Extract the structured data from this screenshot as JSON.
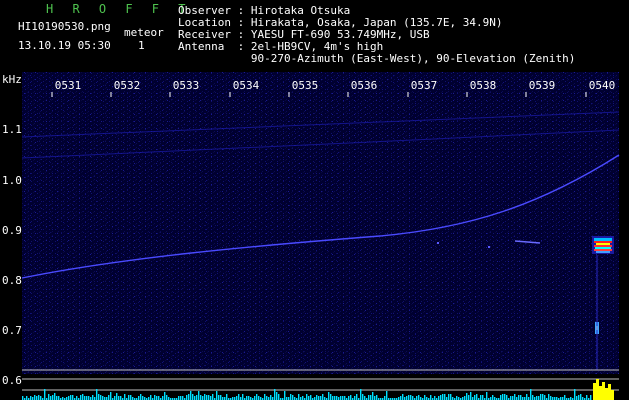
{
  "header": {
    "title": "H R O F F T",
    "filename": "HI10190530.png",
    "detect_label": "meteor",
    "datetime": "13.10.19 05:30",
    "count": "1",
    "info_lines": [
      "Observer : Hirotaka Otsuka",
      "Location : Hirakata, Osaka, Japan (135.7E, 34.9N)",
      "Receiver : YAESU FT-690 53.749MHz, USB",
      "Antenna  : 2el-HB9CV, 4m's high",
      "           90-270-Azimuth (East-West), 90-Elevation (Zenith)"
    ]
  },
  "axes": {
    "y_unit": "kHz",
    "y_ticks": [
      "1.1",
      "1.0",
      "0.9",
      "0.8",
      "0.7",
      "0.6"
    ],
    "x_ticks": [
      "0531",
      "0532",
      "0533",
      "0534",
      "0535",
      "0536",
      "0537",
      "0538",
      "0539",
      "0540"
    ]
  },
  "colors": {
    "background": "#000000",
    "spectrogram_bg": "#000038",
    "trace": "#4a4aff",
    "title": "#4ec24e",
    "meteor_hot": "#ff2020",
    "meteor_warm": "#ffff00",
    "meteor_cool": "#00ffff",
    "histogram": "#00e0ff",
    "histogram_peak": "#ffff00"
  }
}
